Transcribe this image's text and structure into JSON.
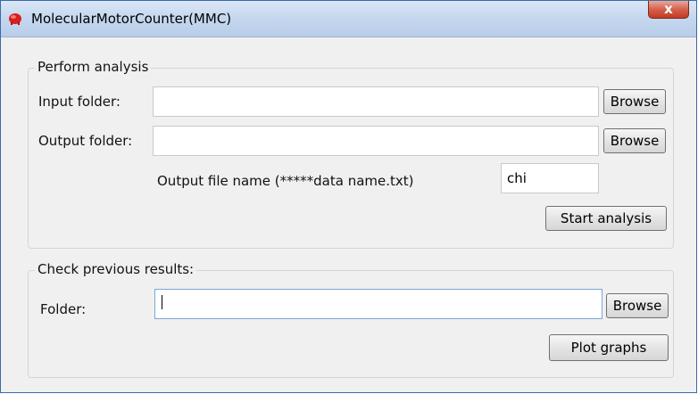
{
  "window": {
    "title": "MolecularMotorCounter(MMC)",
    "close_glyph": "x"
  },
  "perform": {
    "title": "Perform analysis",
    "input_label": "Input folder:",
    "input_value": "",
    "output_label": "Output folder:",
    "output_value": "",
    "browse_label": "Browse",
    "filename_label": "Output file name (*****data name.txt)",
    "filename_value": "chi",
    "start_label": "Start analysis"
  },
  "check": {
    "title": "Check previous results:",
    "folder_label": "Folder:",
    "folder_value": "",
    "browse_label": "Browse",
    "plot_label": "Plot graphs"
  },
  "icons": {
    "app": "red-motor-icon",
    "close": "close-icon"
  },
  "colors": {
    "titlebar": "#c6d8ef",
    "close": "#c23b22",
    "focus_border": "#7aa7d8"
  }
}
